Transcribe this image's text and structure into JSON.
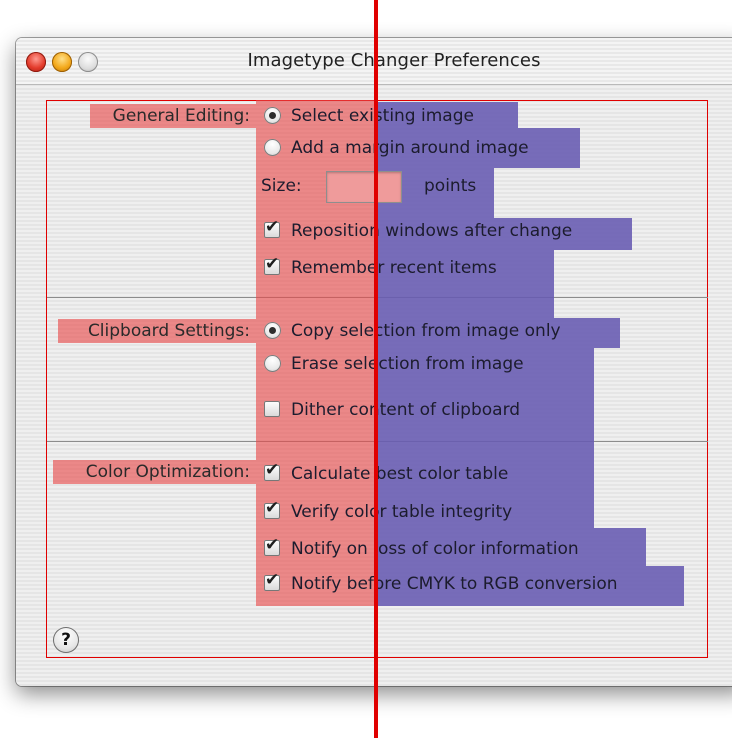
{
  "window": {
    "title": "Imagetype Changer Preferences"
  },
  "sections": [
    {
      "label": "General Editing:",
      "options": [
        {
          "type": "radio",
          "label": "Select existing image",
          "checked": true
        },
        {
          "type": "radio",
          "label": "Add a margin around image",
          "checked": false
        },
        {
          "type": "field",
          "label": "Size:",
          "value": "",
          "unit": "points"
        },
        {
          "type": "checkbox",
          "label": "Reposition windows after change",
          "checked": true
        },
        {
          "type": "checkbox",
          "label": "Remember recent items",
          "checked": true
        }
      ]
    },
    {
      "label": "Clipboard Settings:",
      "options": [
        {
          "type": "radio",
          "label": "Copy selection from image only",
          "checked": true
        },
        {
          "type": "radio",
          "label": "Erase selection from image",
          "checked": false
        },
        {
          "type": "checkbox",
          "label": "Dither content of clipboard",
          "checked": false
        }
      ]
    },
    {
      "label": "Color Optimization:",
      "options": [
        {
          "type": "checkbox",
          "label": "Calculate best color table",
          "checked": true
        },
        {
          "type": "checkbox",
          "label": "Verify color table integrity",
          "checked": true
        },
        {
          "type": "checkbox",
          "label": "Notify on loss of color information",
          "checked": true
        },
        {
          "type": "checkbox",
          "label": "Notify before CMYK to RGB conversion",
          "checked": true
        }
      ]
    }
  ],
  "help": {
    "glyph": "?"
  },
  "colors": {
    "label_highlight": "#e84848",
    "control_highlight": "#665ab2",
    "annotation_line": "#e00000"
  }
}
